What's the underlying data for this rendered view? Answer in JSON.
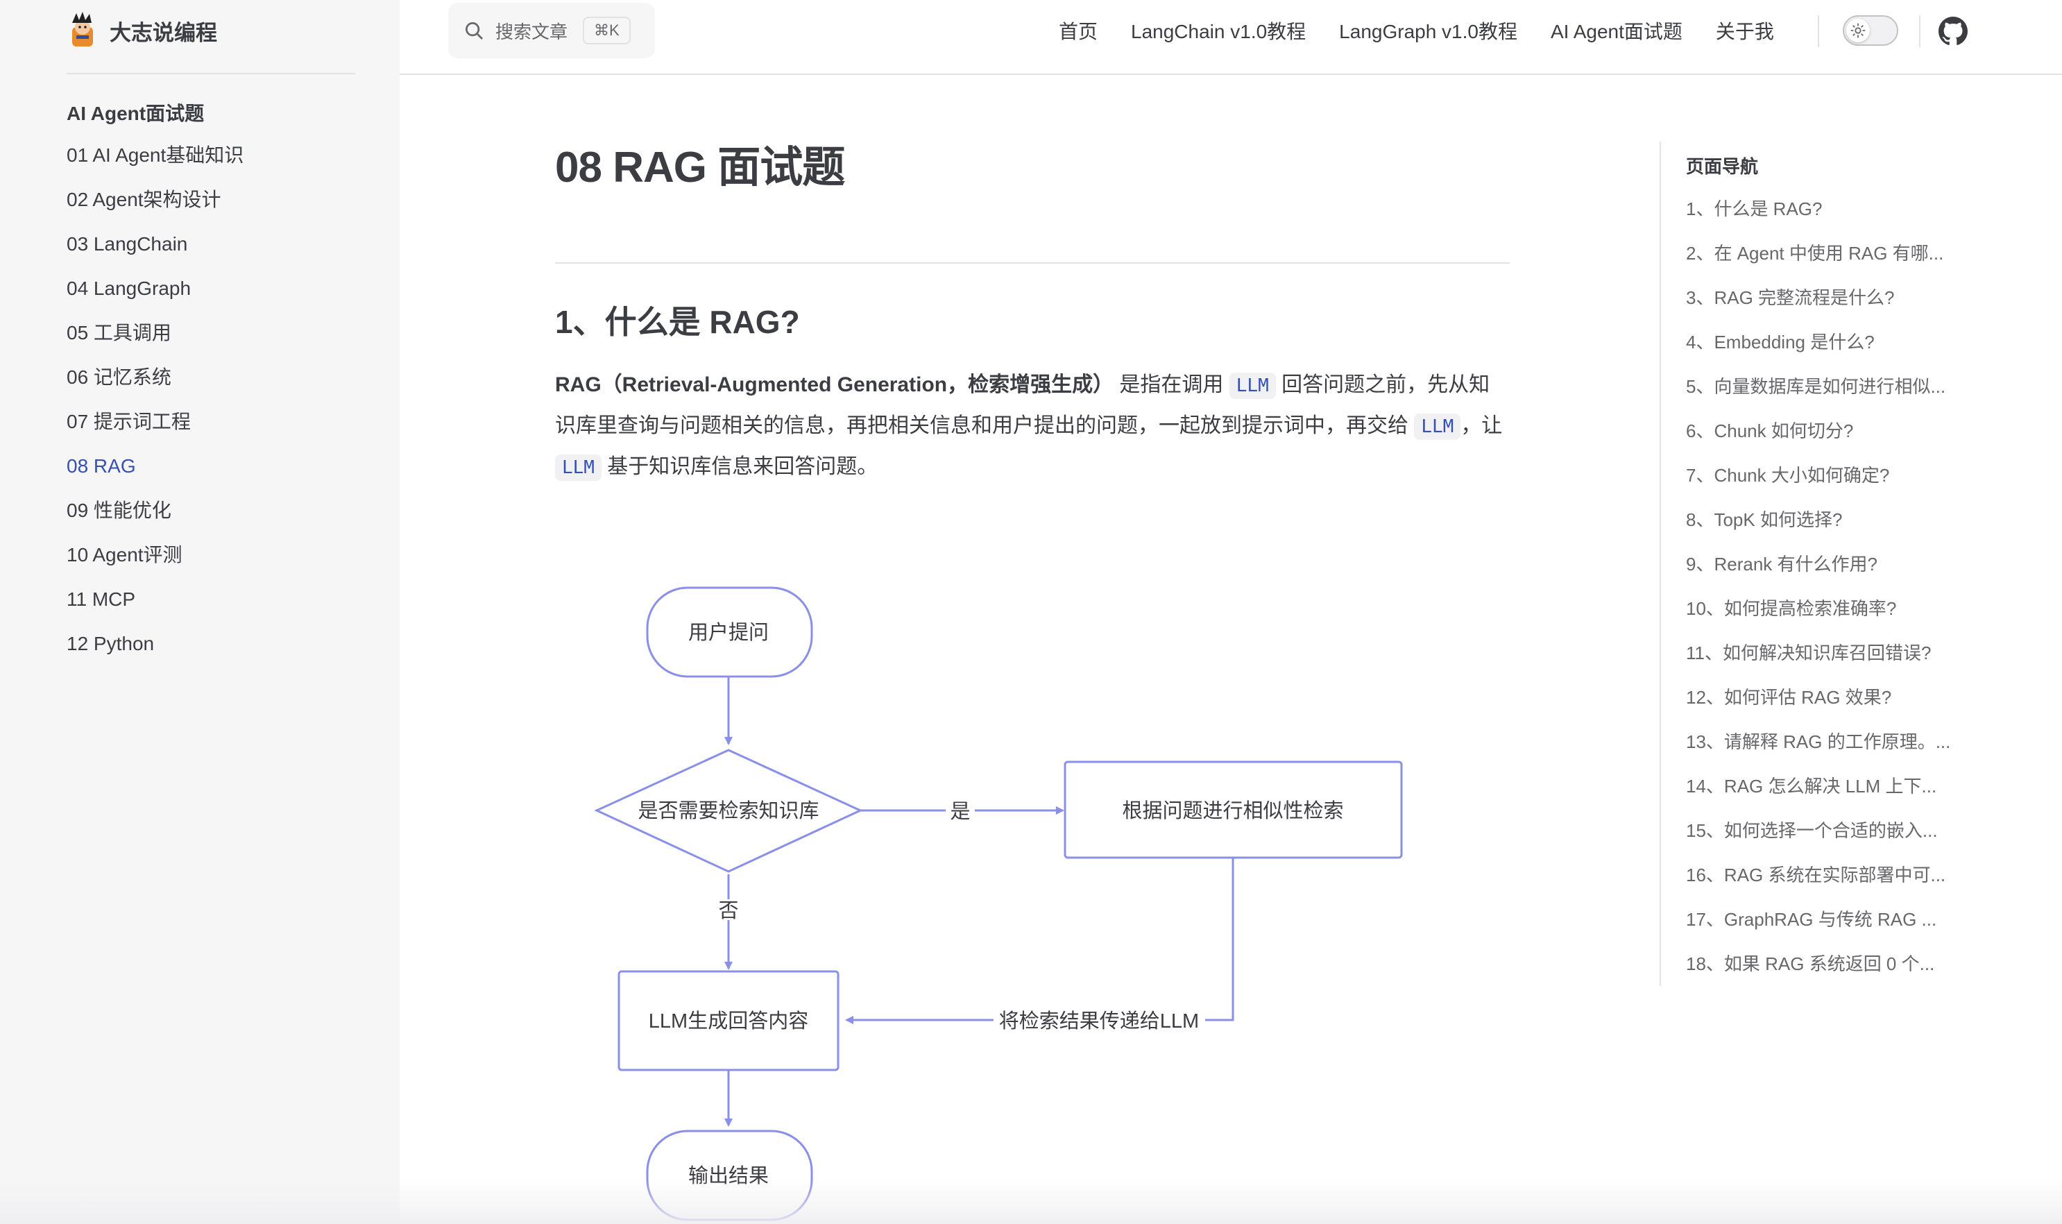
{
  "site": {
    "title": "大志说编程"
  },
  "search": {
    "placeholder": "搜索文章",
    "shortcut": "⌘K"
  },
  "topnav": {
    "links": [
      "首页",
      "LangChain v1.0教程",
      "LangGraph v1.0教程",
      "AI Agent面试题",
      "关于我"
    ]
  },
  "sidebar": {
    "heading": "AI Agent面试题",
    "items": [
      {
        "label": "01 AI Agent基础知识"
      },
      {
        "label": "02 Agent架构设计"
      },
      {
        "label": "03 LangChain"
      },
      {
        "label": "04 LangGraph"
      },
      {
        "label": "05 工具调用"
      },
      {
        "label": "06 记忆系统"
      },
      {
        "label": "07 提示词工程"
      },
      {
        "label": "08 RAG",
        "active": true
      },
      {
        "label": "09 性能优化"
      },
      {
        "label": "10 Agent评测"
      },
      {
        "label": "11 MCP"
      },
      {
        "label": "12 Python"
      }
    ]
  },
  "doc": {
    "title": "08 RAG 面试题",
    "section1_heading": "1、什么是 RAG?",
    "para": {
      "bold": "RAG（Retrieval-Augmented Generation，检索增强生成）",
      "t1": " 是指在调用 ",
      "code1": "LLM",
      "t2": " 回答问题之前，先从知识库里查询与问题相关的信息，再把相关信息和用户提出的问题，一起放到提示词中，再交给 ",
      "code2": "LLM",
      "t3": "，让 ",
      "code3": "LLM",
      "t4": " 基于知识库信息来回答问题。"
    }
  },
  "flowchart": {
    "start": "用户提问",
    "decision": "是否需要检索知识库",
    "yes_label": "是",
    "no_label": "否",
    "retrieve": "根据问题进行相似性检索",
    "generate": "LLM生成回答内容",
    "pass_label": "将检索结果传递给LLM",
    "end": "输出结果",
    "stroke_color": "#8a8fe8",
    "fill_color": "#ffffff"
  },
  "toc": {
    "title": "页面导航",
    "items": [
      "1、什么是 RAG?",
      "2、在 Agent 中使用 RAG 有哪...",
      "3、RAG 完整流程是什么?",
      "4、Embedding 是什么?",
      "5、向量数据库是如何进行相似...",
      "6、Chunk 如何切分?",
      "7、Chunk 大小如何确定?",
      "8、TopK 如何选择?",
      "9、Rerank 有什么作用?",
      "10、如何提高检索准确率?",
      "11、如何解决知识库召回错误?",
      "12、如何评估 RAG 效果?",
      "13、请解释 RAG 的工作原理。...",
      "14、RAG 怎么解决 LLM 上下...",
      "15、如何选择一个合适的嵌入...",
      "16、RAG 系统在实际部署中可...",
      "17、GraphRAG 与传统 RAG ...",
      "18、如果 RAG 系统返回 0 个..."
    ]
  },
  "colors": {
    "brand": "#3451b2",
    "text": "#3c3c43",
    "muted": "#67676c",
    "sidebar_bg": "#f6f6f7"
  }
}
